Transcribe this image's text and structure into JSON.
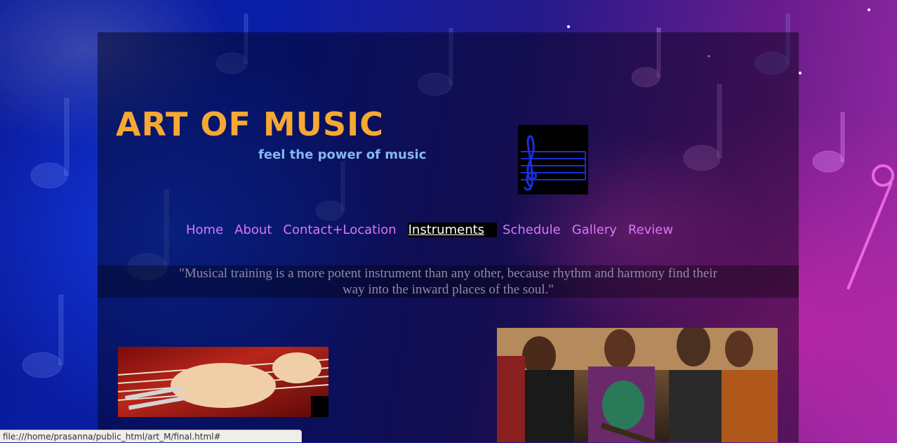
{
  "header": {
    "site_title": "ART OF MUSIC",
    "tagline": "feel the power of music"
  },
  "nav": {
    "items": [
      {
        "label": "Home"
      },
      {
        "label": "About"
      },
      {
        "label": "Contact+Location"
      },
      {
        "label": "Instruments",
        "active": true
      },
      {
        "label": "Schedule"
      },
      {
        "label": "Gallery"
      },
      {
        "label": "Review"
      }
    ]
  },
  "quote": {
    "text": "\"Musical training is a more potent instrument than any other, because rhythm and harmony find their way into the inward places of the soul.\""
  },
  "status_bar": {
    "url": "file:///home/prasanna/public_html/art_M/final.html#"
  },
  "colors": {
    "title": "#f6a833",
    "tagline": "#84b8ee",
    "nav_link": "#d878f4",
    "nav_active_bg": "#000000",
    "quote_text": "#8f8aa8"
  }
}
